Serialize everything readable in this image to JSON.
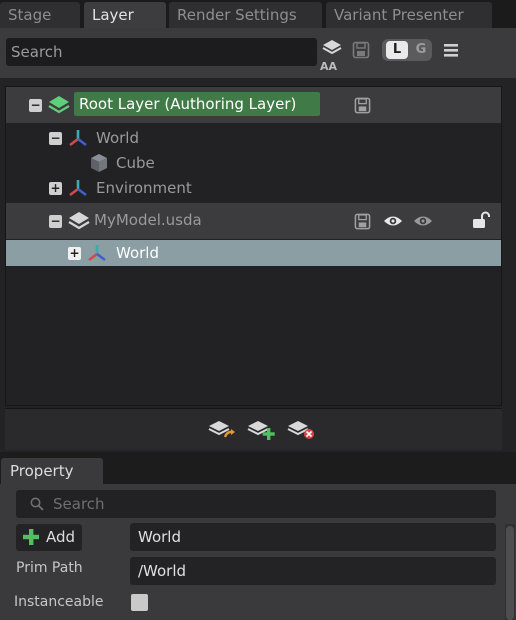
{
  "tabs": [
    {
      "label": "Stage",
      "active": false
    },
    {
      "label": "Layer",
      "active": true
    },
    {
      "label": "Render Settings",
      "active": false
    },
    {
      "label": "Variant Presenter",
      "active": false
    }
  ],
  "toolbar": {
    "search_placeholder": "Search",
    "aa_label": "AA",
    "toggle_l": "L",
    "toggle_g": "G",
    "icons": [
      "layers-icon",
      "save-icon",
      "menu-icon"
    ]
  },
  "tree": {
    "root_layer": "Root Layer (Authoring Layer)",
    "world": "World",
    "cube": "Cube",
    "environment": "Environment",
    "mymodel": "MyModel.usda",
    "mymodel_world": "World"
  },
  "colors": {
    "accent_green": "#3f7a47",
    "selection": "#8b9ea3",
    "prim_red": "#d14a4a",
    "prim_teal": "#3fa8b0",
    "prim_blue": "#3f5fd0"
  },
  "property": {
    "tab_label": "Property",
    "search_placeholder": "Search",
    "add_label": "Add",
    "name_value": "World",
    "prim_path_label": "Prim Path",
    "prim_path_value": "/World",
    "instanceable_label": "Instanceable",
    "instanceable_checked": false
  }
}
